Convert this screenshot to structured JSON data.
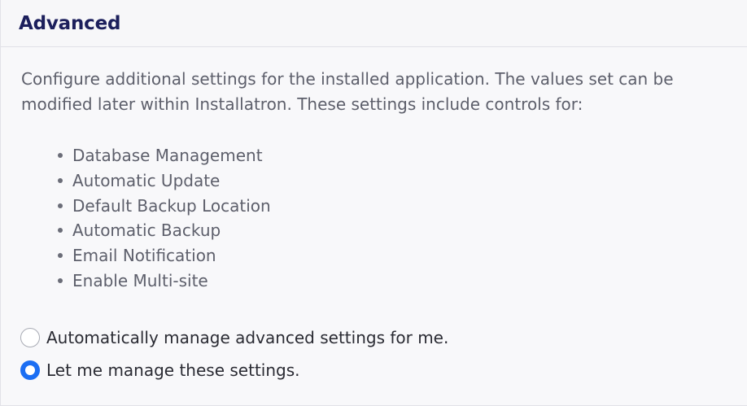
{
  "panel": {
    "title": "Advanced"
  },
  "description": "Configure additional settings for the installed application. The values set can be modified later within Installatron. These settings include controls for:",
  "features": [
    "Database Management",
    "Automatic Update",
    "Default Backup Location",
    "Automatic Backup",
    "Email Notification",
    "Enable Multi-site"
  ],
  "options": [
    {
      "label": "Automatically manage advanced settings for me.",
      "selected": false
    },
    {
      "label": "Let me manage these settings.",
      "selected": true
    }
  ],
  "colors": {
    "accent": "#1b6ef3",
    "title": "#1c1f5c",
    "body_text": "#5d5f6b"
  }
}
